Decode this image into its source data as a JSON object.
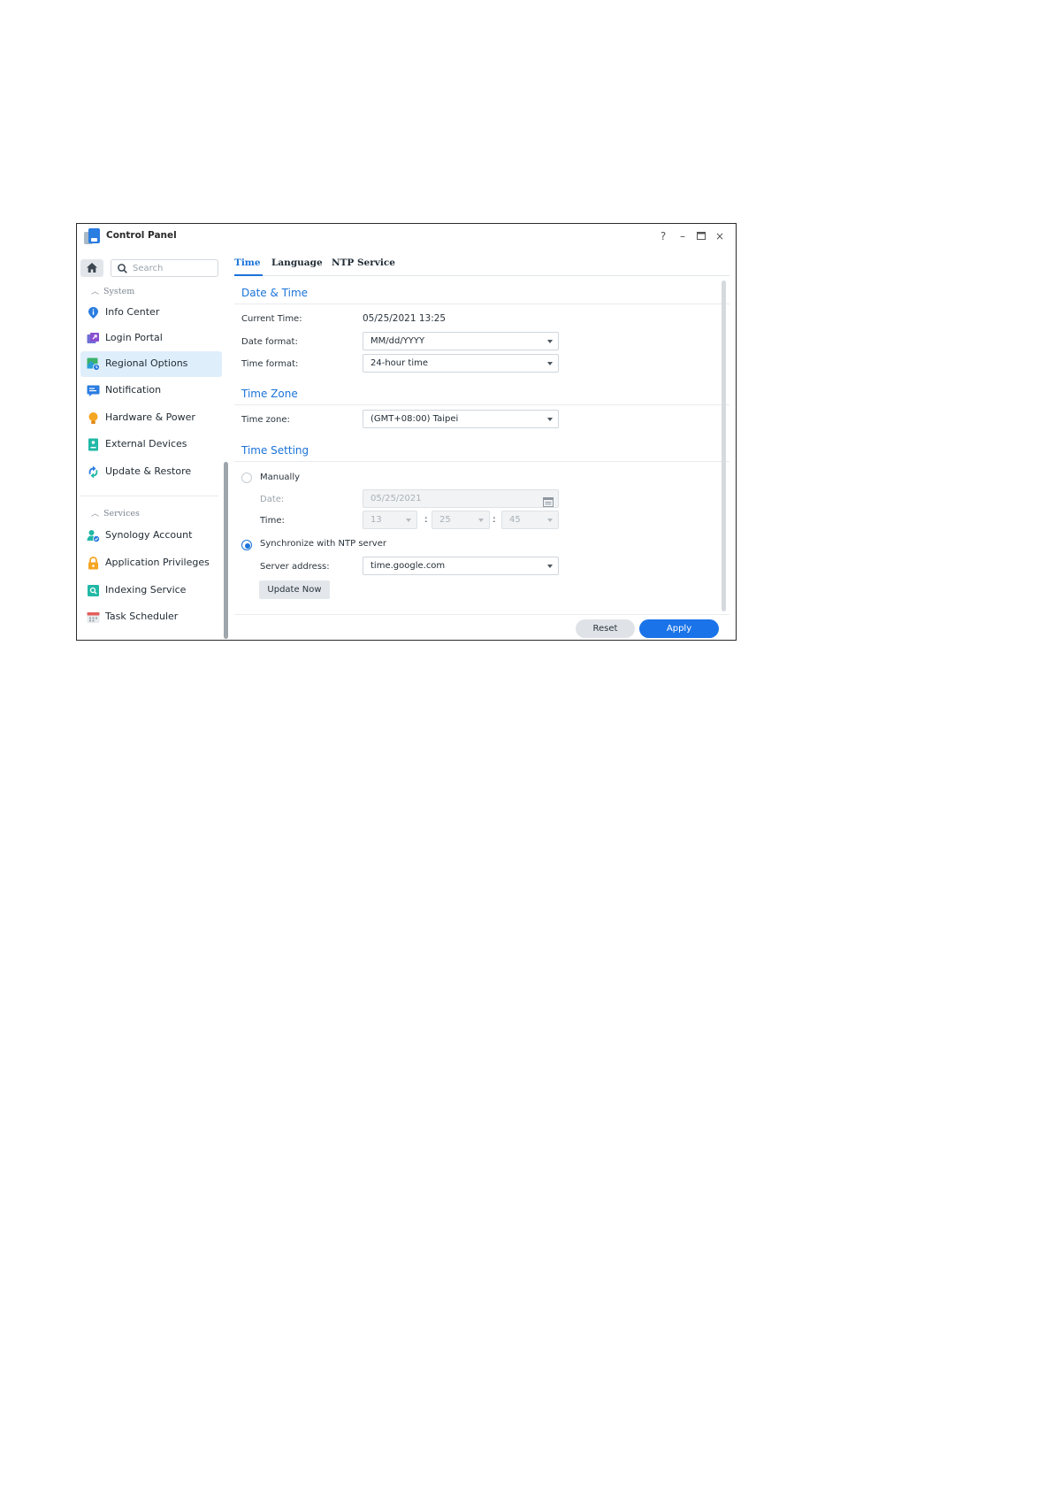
{
  "window": {
    "title": "Control Panel",
    "controls": [
      "?",
      "–",
      "▭",
      "×"
    ]
  },
  "sidebar": {
    "search_placeholder": "Search",
    "sections": [
      {
        "title": "System",
        "items": [
          {
            "label": "Info Center",
            "icon": "info-icon"
          },
          {
            "label": "Login Portal",
            "icon": "login-portal-icon"
          },
          {
            "label": "Regional Options",
            "icon": "regional-options-icon",
            "selected": true
          },
          {
            "label": "Notification",
            "icon": "notification-icon"
          },
          {
            "label": "Hardware & Power",
            "icon": "hardware-power-icon"
          },
          {
            "label": "External Devices",
            "icon": "external-devices-icon"
          },
          {
            "label": "Update & Restore",
            "icon": "update-restore-icon"
          }
        ]
      },
      {
        "title": "Services",
        "items": [
          {
            "label": "Synology Account",
            "icon": "synology-account-icon"
          },
          {
            "label": "Application Privileges",
            "icon": "lock-icon"
          },
          {
            "label": "Indexing Service",
            "icon": "indexing-service-icon"
          },
          {
            "label": "Task Scheduler",
            "icon": "calendar-icon"
          }
        ]
      }
    ]
  },
  "tabs": [
    "Time",
    "Language",
    "NTP Service"
  ],
  "active_tab": "Time",
  "date_time": {
    "title": "Date & Time",
    "current_time_label": "Current Time:",
    "current_time_value": "05/25/2021 13:25",
    "date_format_label": "Date format:",
    "date_format_value": "MM/dd/YYYY",
    "time_format_label": "Time format:",
    "time_format_value": "24-hour time"
  },
  "time_zone": {
    "title": "Time Zone",
    "label": "Time zone:",
    "value": "(GMT+08:00) Taipei"
  },
  "time_setting": {
    "title": "Time Setting",
    "manual_label": "Manually",
    "manual_selected": false,
    "date_label": "Date:",
    "date_value": "05/25/2021",
    "time_label": "Time:",
    "hour": "13",
    "minute": "25",
    "second": "45",
    "ntp_label": "Synchronize with NTP server",
    "ntp_selected": true,
    "server_label": "Server address:",
    "server_value": "time.google.com",
    "update_now": "Update Now"
  },
  "footer": {
    "reset": "Reset",
    "apply": "Apply"
  },
  "colors": {
    "accent": "#1a73d9",
    "apply": "#1a73e8",
    "selected_bg": "#dfeefb"
  }
}
